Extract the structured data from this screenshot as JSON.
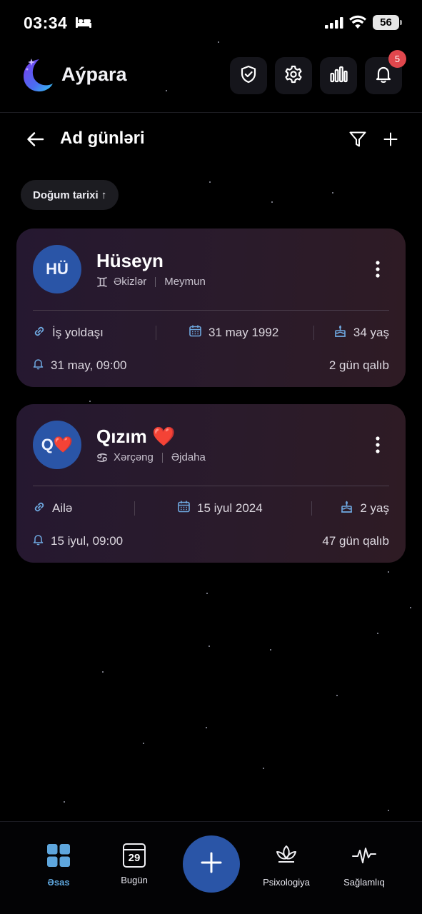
{
  "status_bar": {
    "time": "03:34",
    "battery": "56"
  },
  "app": {
    "title": "Aýpara",
    "notification_count": "5"
  },
  "page": {
    "title": "Ad günləri",
    "sort_chip": "Doğum tarixi ↑"
  },
  "cards": [
    {
      "initials": "HÜ",
      "name": "Hüseyn",
      "zodiac": "Əkizlər",
      "chinese_zodiac": "Meymun",
      "relation": "İş yoldaşı",
      "birth_date": "31 may 1992",
      "age": "34 yaş",
      "reminder": "31 may, 09:00",
      "days_left": "2 gün qalıb"
    },
    {
      "initials": "Q❤️",
      "name": "Qızım ❤️",
      "zodiac": "Xərçəng",
      "chinese_zodiac": "Əjdaha",
      "relation": "Ailə",
      "birth_date": "15 iyul 2024",
      "age": "2 yaş",
      "reminder": "15 iyul, 09:00",
      "days_left": "47 gün qalıb"
    }
  ],
  "bottom_nav": {
    "home": "Əsas",
    "today": "Bugün",
    "today_day": "29",
    "psychology": "Psixologiya",
    "health": "Sağlamlıq"
  },
  "colors": {
    "accent": "#2a55a7",
    "active_nav": "#5ea6dd",
    "badge": "#e0474d",
    "icon_blue": "#6ea8e0"
  }
}
